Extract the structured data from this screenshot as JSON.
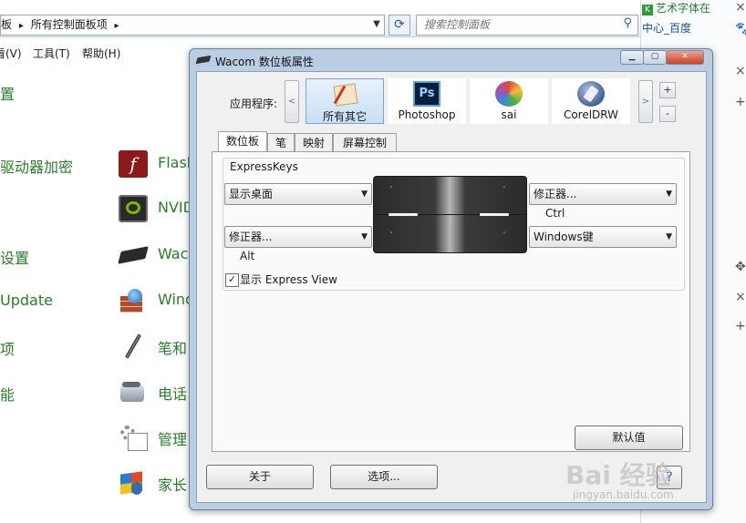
{
  "explorer": {
    "address_prefix": "板",
    "breadcrumb_sep": "▸",
    "breadcrumb": "所有控制面板项",
    "search_placeholder": "搜索控制面板",
    "menu": [
      "看(V)",
      "工具(T)",
      "帮助(H)"
    ],
    "left_items": [
      "置",
      "驱动器加密",
      "设置",
      "Update",
      "项",
      "能"
    ],
    "items": [
      {
        "label": "Flash",
        "icon": "flash-icon",
        "color": "#8b1a1a"
      },
      {
        "label": "NVID",
        "icon": "nvidia-icon",
        "color": "#3a3a3a"
      },
      {
        "label": "Wac",
        "icon": "wacom-tablet-icon",
        "color": "#2a2a2a"
      },
      {
        "label": "Wind",
        "icon": "firewall-icon",
        "color": "#5a7fb0"
      },
      {
        "label": "笔和",
        "icon": "pen-icon",
        "color": "#4a4a4a"
      },
      {
        "label": "电话",
        "icon": "phone-icon",
        "color": "#6a7a8a"
      },
      {
        "label": "管理",
        "icon": "admin-tools-icon",
        "color": "#7a8a9a"
      },
      {
        "label": "家长",
        "icon": "parental-controls-icon",
        "color": "#3a6ab0"
      }
    ],
    "right_tabs": [
      "艺术字体在",
      "中心_百度"
    ],
    "right_icons": [
      "×",
      "+",
      "✥",
      "×",
      "+"
    ]
  },
  "dialog": {
    "title": "Wacom 数位板属性",
    "app_label": "应用程序:",
    "apps": [
      {
        "label": "所有其它",
        "icon": "all-other-apps-icon",
        "selected": true
      },
      {
        "label": "Photoshop",
        "icon": "photoshop-icon",
        "selected": false
      },
      {
        "label": "sai",
        "icon": "sai-icon",
        "selected": false
      },
      {
        "label": "CorelDRW",
        "icon": "coreldraw-icon",
        "selected": false
      }
    ],
    "tabs": [
      "数位板",
      "笔",
      "映射",
      "屏幕控制"
    ],
    "active_tab": "数位板",
    "group_label": "ExpressKeys",
    "keys": {
      "top_left": "显示桌面",
      "bottom_left": "修正器...",
      "bottom_left_sub": "Alt",
      "top_right": "修正器...",
      "top_right_sub": "Ctrl",
      "bottom_right": "Windows键"
    },
    "show_express_view": "显示 Express View",
    "show_express_view_checked": true,
    "default_button": "默认值",
    "about_button": "关于",
    "options_button": "选项...",
    "scroll_left": "<",
    "scroll_right": ">",
    "add": "+",
    "remove": "-"
  },
  "watermark": "Bai 经验",
  "watermark_url": "jingyan.baidu.com",
  "colors": {
    "link_green": "#2a7d2a",
    "title_blue": "#b9cde3"
  }
}
